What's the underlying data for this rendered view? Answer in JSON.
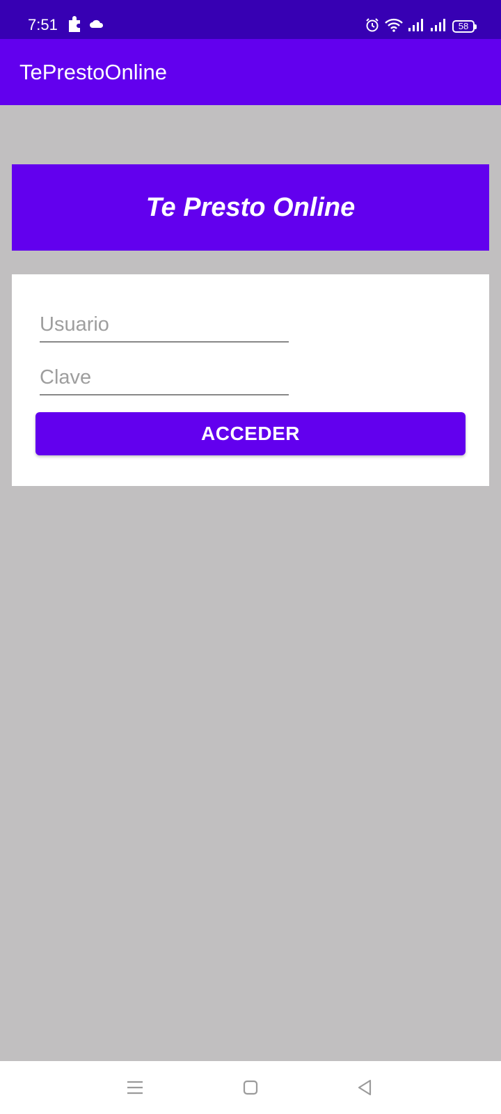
{
  "status_bar": {
    "time": "7:51",
    "battery": "58",
    "icons": [
      "puzzle-icon",
      "cloud-icon",
      "alarm-icon",
      "wifi-icon",
      "signal-icon",
      "signal-icon",
      "battery-icon"
    ]
  },
  "app_bar": {
    "title": "TePrestoOnline"
  },
  "banner": {
    "text": "Te Presto Online"
  },
  "login": {
    "username_placeholder": "Usuario",
    "password_placeholder": "Clave",
    "submit_label": "ACCEDER"
  },
  "nav_bar": {
    "icons": [
      "menu-icon",
      "home-icon",
      "back-icon"
    ]
  },
  "colors": {
    "status_bar": "#3700b3",
    "primary": "#6200ee",
    "background": "#c1bfc0",
    "card": "#ffffff"
  }
}
